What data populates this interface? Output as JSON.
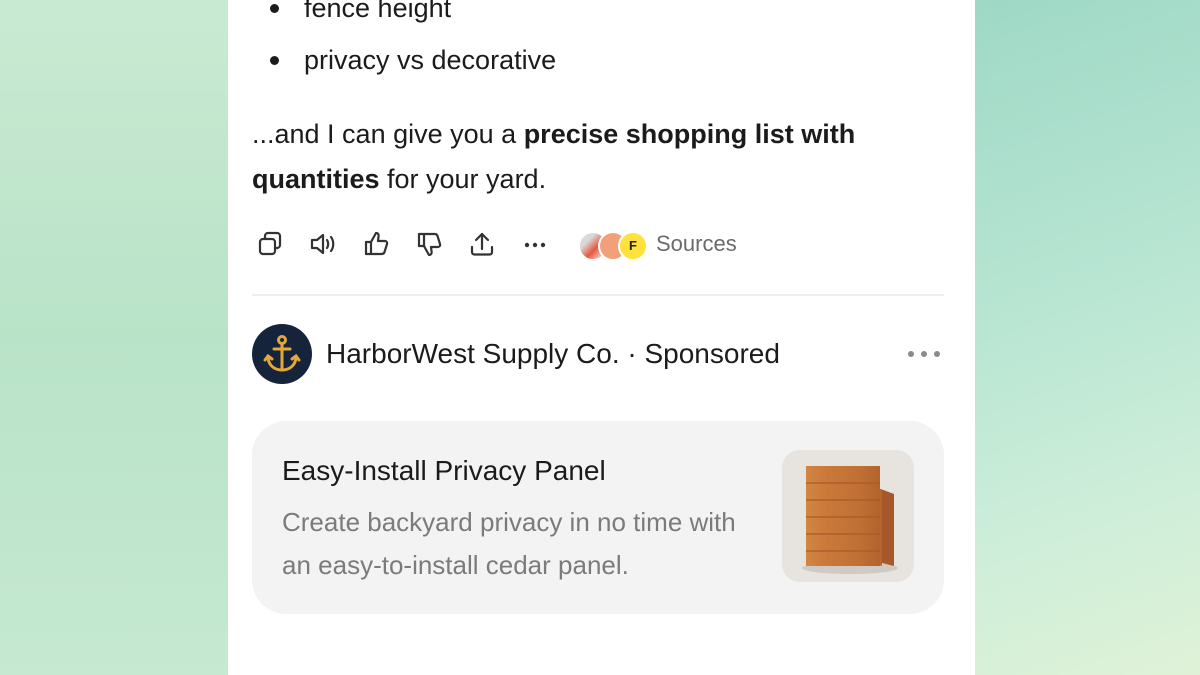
{
  "message": {
    "bullets": [
      "fence height",
      "privacy vs decorative"
    ],
    "para_pre": "...and I can give you a ",
    "para_bold1": "precise shopping list with",
    "para_bold2": "quantities",
    "para_post": " for your yard."
  },
  "actions": {
    "icons": [
      "copy-icon",
      "read-aloud-icon",
      "thumbs-up-icon",
      "thumbs-down-icon",
      "share-icon",
      "more-icon"
    ],
    "favicon_letter": "F",
    "sources_label": "Sources"
  },
  "ad": {
    "advertiser": "HarborWest Supply Co. · Sponsored",
    "logo_icon": "anchor-icon",
    "card_title": "Easy-Install Privacy Panel",
    "card_desc": "Create backyard privacy in no time with an easy-to-install cedar panel.",
    "thumbnail": "cedar-panel-image"
  },
  "colors": {
    "text": "#1b1b1b",
    "muted": "#7b7b7b",
    "logo_bg": "#15243a",
    "anchor_gold": "#e4a83a",
    "card_bg": "#f3f3f3"
  }
}
